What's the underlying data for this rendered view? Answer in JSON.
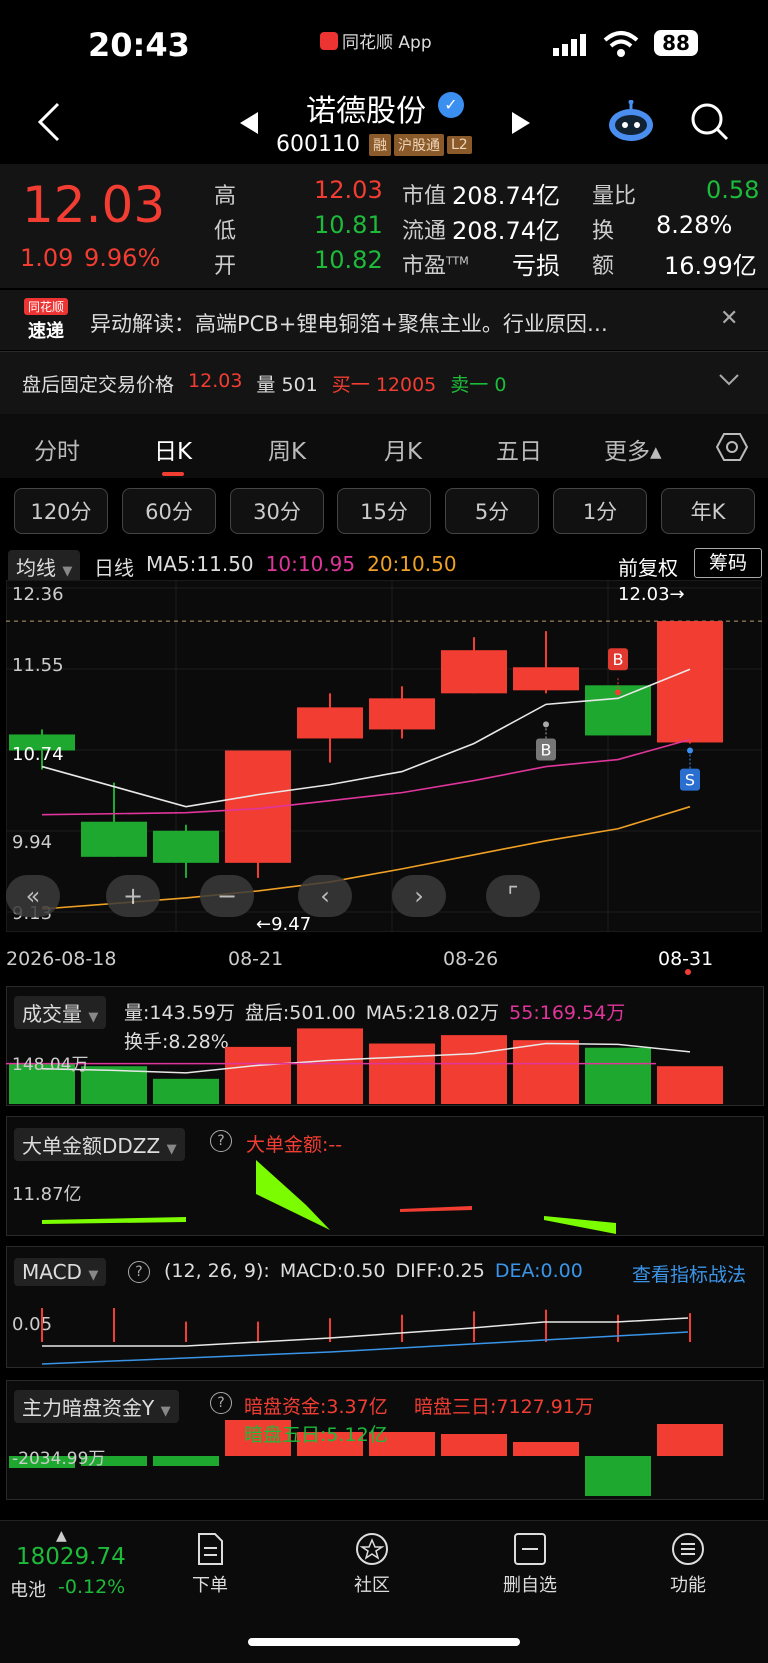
{
  "status": {
    "time": "20:43",
    "app_label": "同花顺 App",
    "battery": "88"
  },
  "header": {
    "stock_name": "诺德股份",
    "code": "600110",
    "tags": [
      "融",
      "沪股通",
      "L2"
    ]
  },
  "quote": {
    "price": "12.03",
    "change": "1.09",
    "change_pct": "9.96%",
    "high_label": "高",
    "high": "12.03",
    "low_label": "低",
    "low": "10.81",
    "open_label": "开",
    "open": "10.82",
    "mcap_label": "市值",
    "mcap": "208.74亿",
    "float_label": "流通",
    "float": "208.74亿",
    "pe_label": "市盈",
    "pe_sup": "TTM",
    "pe": "亏损",
    "vr_label": "量比",
    "vr": "0.58",
    "turn_label": "换",
    "turn": "8.28%",
    "amt_label": "额",
    "amt": "16.99亿"
  },
  "news": {
    "logo_top": "同花顺",
    "logo_bottom": "速递",
    "text": "异动解读：高端PCB+锂电铜箔+聚焦主业。行业原因…"
  },
  "afterhours": {
    "label": "盘后固定交易价格",
    "price": "12.03",
    "vol_label": "量",
    "vol": "501",
    "buy_label": "买一",
    "buy": "12005",
    "sell_label": "卖一",
    "sell": "0"
  },
  "tabs": [
    "分时",
    "日K",
    "周K",
    "月K",
    "五日",
    "更多▴"
  ],
  "periods": [
    "120分",
    "60分",
    "30分",
    "15分",
    "5分",
    "1分",
    "年K"
  ],
  "kline": {
    "indicator_label": "均线",
    "period_label": "日线",
    "ma5": "MA5:11.50",
    "ma10": "10:10.95",
    "ma20": "20:10.50",
    "adjust": "前复权",
    "chips": "筹码",
    "y_labels": [
      "12.36",
      "11.55",
      "10.74",
      "9.94",
      "9.13"
    ],
    "max_label": "12.03→",
    "min_label": "←9.47",
    "x_labels": [
      "2026-08-18",
      "08-21",
      "08-26",
      "08-31"
    ],
    "marker_b": "B",
    "marker_s": "S"
  },
  "chart_data": {
    "type": "candlestick",
    "dates_shown": [
      "2026-08-18",
      "08-21",
      "08-26",
      "08-31"
    ],
    "candles": [
      {
        "open": 10.9,
        "close": 10.74,
        "high": 10.95,
        "low": 10.55,
        "color": "green"
      },
      {
        "open": 10.03,
        "close": 9.68,
        "high": 10.42,
        "low": 9.68,
        "color": "green"
      },
      {
        "open": 9.94,
        "close": 9.62,
        "high": 10.0,
        "low": 9.47,
        "color": "green"
      },
      {
        "open": 9.62,
        "close": 10.74,
        "high": 10.74,
        "low": 9.47,
        "color": "red"
      },
      {
        "open": 10.86,
        "close": 11.17,
        "high": 11.31,
        "low": 10.62,
        "color": "red"
      },
      {
        "open": 10.95,
        "close": 11.26,
        "high": 11.38,
        "low": 10.86,
        "color": "red"
      },
      {
        "open": 11.31,
        "close": 11.74,
        "high": 11.87,
        "low": 11.31,
        "color": "red"
      },
      {
        "open": 11.34,
        "close": 11.57,
        "high": 11.93,
        "low": 11.31,
        "color": "red"
      },
      {
        "open": 11.39,
        "close": 10.89,
        "high": 11.39,
        "low": 10.89,
        "color": "green"
      },
      {
        "open": 10.82,
        "close": 12.03,
        "high": 12.03,
        "low": 10.81,
        "color": "red"
      }
    ],
    "ma5": [
      10.58,
      null,
      10.18,
      10.3,
      10.4,
      10.53,
      10.81,
      11.2,
      11.26,
      11.55
    ],
    "ma10": [
      10.1,
      null,
      10.12,
      10.16,
      10.24,
      10.32,
      10.44,
      10.58,
      10.65,
      10.85
    ],
    "ma20": [
      9.16,
      null,
      9.27,
      9.34,
      9.43,
      9.56,
      9.7,
      9.84,
      9.96,
      10.18
    ],
    "ylim": [
      9.13,
      12.36
    ]
  },
  "volume": {
    "label": "成交量",
    "vol": "量:143.59万",
    "after": "盘后:501.00",
    "ma5": "MA5:218.02万",
    "ma55": "55:169.54万",
    "turnover": "换手:8.28%",
    "y_label": "148.04万",
    "bars": [
      0.48,
      0.45,
      0.3,
      0.68,
      0.9,
      0.72,
      0.82,
      0.76,
      0.67,
      0.45
    ],
    "colors": [
      "green",
      "green",
      "green",
      "red",
      "red",
      "red",
      "red",
      "red",
      "green",
      "red"
    ]
  },
  "ddzz": {
    "label": "大单金额DDZZ",
    "value_label": "大单金额:--",
    "y_label": "11.87亿"
  },
  "macd": {
    "label": "MACD",
    "params": "(12, 26, 9):",
    "macd": "MACD:0.50",
    "diff": "DIFF:0.25",
    "dea": "DEA:0.00",
    "link": "查看指标战法",
    "y_label": "0.05"
  },
  "dark": {
    "label": "主力暗盘资金Y",
    "v1": "暗盘资金:3.37亿",
    "v2": "暗盘三日:7127.91万",
    "v3": "暗盘五日:5.12亿",
    "y_label": "-2034.99万",
    "bars": [
      -0.3,
      -0.25,
      -0.25,
      0.9,
      0.6,
      0.6,
      0.55,
      0.35,
      -1.0,
      0.8
    ]
  },
  "bottom": {
    "index_value": "18029.74",
    "index_name": "电池",
    "index_change": "-0.12%",
    "items": [
      "下单",
      "社区",
      "删自选",
      "功能"
    ]
  }
}
